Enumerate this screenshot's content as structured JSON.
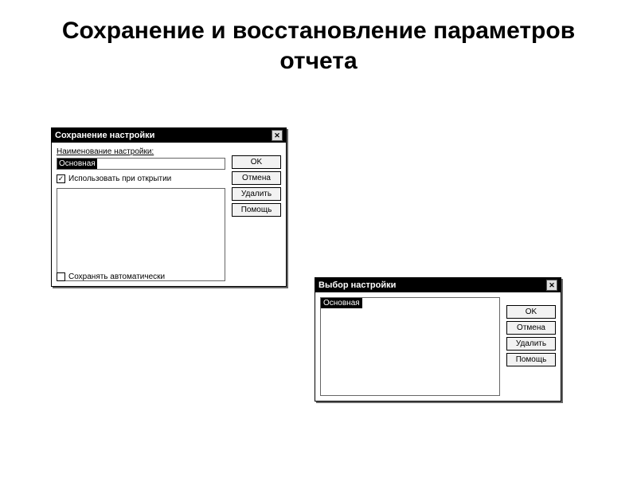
{
  "page_title": "Сохранение и восстановление параметров отчета",
  "dialog_save": {
    "title": "Сохранение настройки",
    "field_label": "Наименование настройки:",
    "field_value": "Основная",
    "use_on_open_label": "Использовать при открытии",
    "use_on_open_checked": true,
    "save_auto_label": "Сохранять автоматически",
    "save_auto_checked": false,
    "buttons": {
      "ok": "OK",
      "cancel": "Отмена",
      "delete": "Удалить",
      "help": "Помощь"
    }
  },
  "dialog_pick": {
    "title": "Выбор настройки",
    "selected_item": "Основная",
    "buttons": {
      "ok": "OK",
      "cancel": "Отмена",
      "delete": "Удалить",
      "help": "Помощь"
    }
  }
}
